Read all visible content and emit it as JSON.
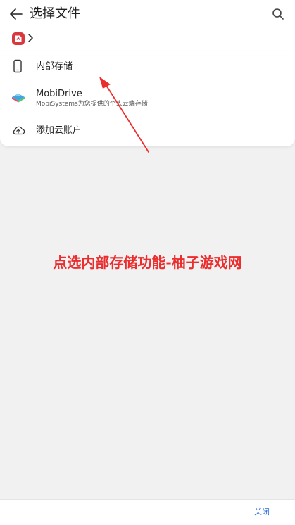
{
  "header": {
    "title": "选择文件",
    "back_icon": "arrow-left-icon",
    "search_icon": "search-icon"
  },
  "breadcrumb": {
    "app_icon": "app-logo-icon",
    "chevron_icon": "chevron-right-icon"
  },
  "locations": [
    {
      "label": "内部存储",
      "icon": "phone-icon"
    },
    {
      "label": "MobiDrive",
      "subtitle": "MobiSystems为您提供的个人云端存储",
      "icon": "mobidrive-logo-icon"
    },
    {
      "label": "添加云账户",
      "icon": "cloud-add-icon"
    }
  ],
  "annotation": {
    "caption": "点选内部存储功能-柚子游戏网",
    "color": "#ec2d2d"
  },
  "footer": {
    "close_label": "关闭"
  },
  "colors": {
    "accent": "#2e6fdb",
    "app_red": "#d9383f",
    "background": "#f1f1f1"
  }
}
